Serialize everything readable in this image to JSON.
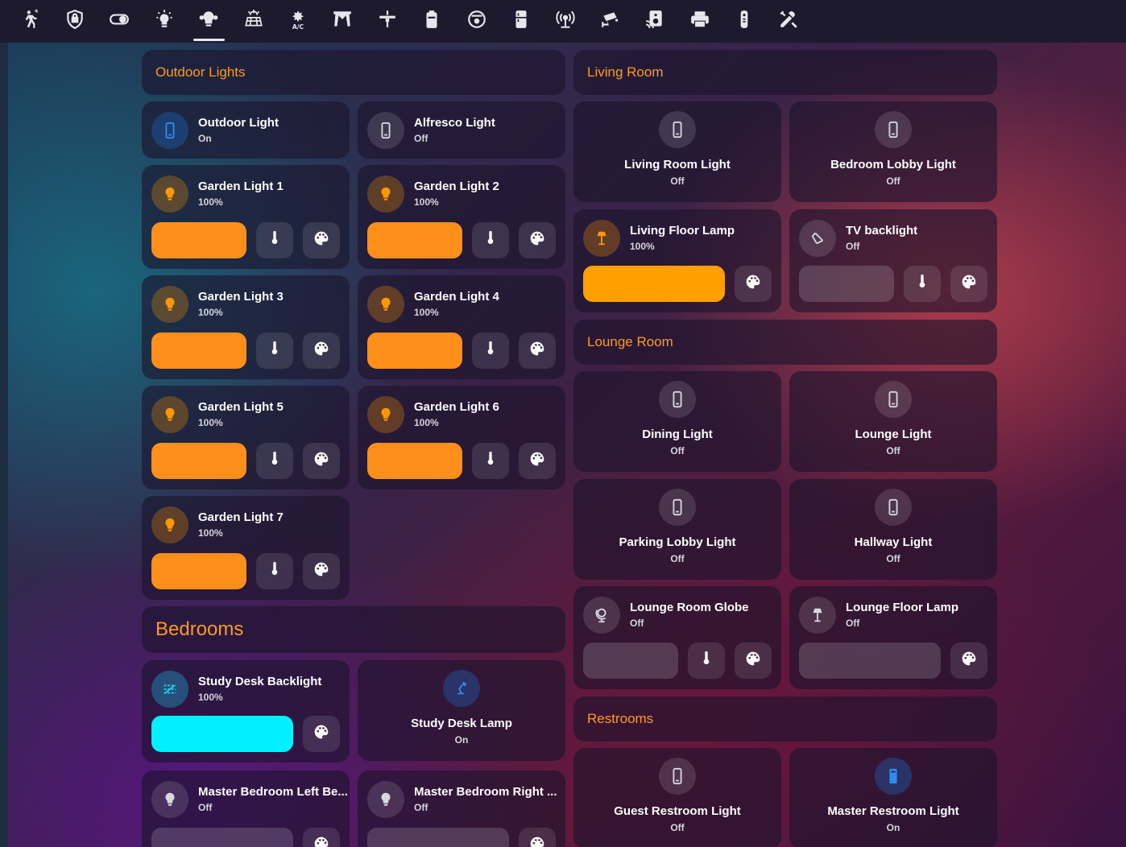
{
  "tabs": [
    {
      "icon": "person-walking-icon"
    },
    {
      "icon": "shield-icon"
    },
    {
      "icon": "toggle-icon"
    },
    {
      "icon": "lightbulb-icon"
    },
    {
      "icon": "bulb-group-icon",
      "active": true
    },
    {
      "icon": "solar-panel-icon"
    },
    {
      "icon": "air-conditioner-icon"
    },
    {
      "icon": "blinds-icon"
    },
    {
      "icon": "ceiling-fan-icon"
    },
    {
      "icon": "battery-icon"
    },
    {
      "icon": "robot-vacuum-icon"
    },
    {
      "icon": "fridge-icon"
    },
    {
      "icon": "router-icon"
    },
    {
      "icon": "cctv-icon"
    },
    {
      "icon": "cast-icon"
    },
    {
      "icon": "printer-icon"
    },
    {
      "icon": "remote-icon"
    },
    {
      "icon": "tools-icon"
    }
  ],
  "tab_ac_text": "A/C",
  "sections": {
    "outdoor": "Outdoor Lights",
    "living": "Living Room",
    "lounge": "Lounge Room",
    "restrooms": "Restrooms",
    "bedrooms": "Bedrooms"
  },
  "lights": {
    "outdoor_light": {
      "name": "Outdoor Light",
      "state": "On"
    },
    "alfresco_light": {
      "name": "Alfresco Light",
      "state": "Off"
    },
    "garden_1": {
      "name": "Garden Light 1",
      "state": "100%"
    },
    "garden_2": {
      "name": "Garden Light 2",
      "state": "100%"
    },
    "garden_3": {
      "name": "Garden Light 3",
      "state": "100%"
    },
    "garden_4": {
      "name": "Garden Light 4",
      "state": "100%"
    },
    "garden_5": {
      "name": "Garden Light 5",
      "state": "100%"
    },
    "garden_6": {
      "name": "Garden Light 6",
      "state": "100%"
    },
    "garden_7": {
      "name": "Garden Light 7",
      "state": "100%"
    },
    "study_backlight": {
      "name": "Study Desk Backlight",
      "state": "100%"
    },
    "study_lamp": {
      "name": "Study Desk Lamp",
      "state": "On"
    },
    "master_left": {
      "name": "Master Bedroom Left Be...",
      "state": "Off"
    },
    "master_right": {
      "name": "Master Bedroom Right ...",
      "state": "Off"
    },
    "living_room_light": {
      "name": "Living Room Light",
      "state": "Off"
    },
    "bedroom_lobby": {
      "name": "Bedroom Lobby Light",
      "state": "Off"
    },
    "living_floor_lamp": {
      "name": "Living Floor Lamp",
      "state": "100%"
    },
    "tv_backlight": {
      "name": "TV backlight",
      "state": "Off"
    },
    "dining_light": {
      "name": "Dining Light",
      "state": "Off"
    },
    "lounge_light": {
      "name": "Lounge Light",
      "state": "Off"
    },
    "parking_lobby": {
      "name": "Parking Lobby Light",
      "state": "Off"
    },
    "hallway_light": {
      "name": "Hallway Light",
      "state": "Off"
    },
    "lounge_globe": {
      "name": "Lounge Room Globe",
      "state": "Off"
    },
    "lounge_floor_lamp": {
      "name": "Lounge Floor Lamp",
      "state": "Off"
    },
    "guest_restroom": {
      "name": "Guest Restroom Light",
      "state": "Off"
    },
    "master_restroom": {
      "name": "Master Restroom Light",
      "state": "On"
    }
  },
  "colors": {
    "accent": "#ff9a1f",
    "slider_on": "#ff8f1b",
    "slider_amber": "#ffa000",
    "slider_cyan": "#00f0ff",
    "on_blue": "#2e8cf0"
  }
}
